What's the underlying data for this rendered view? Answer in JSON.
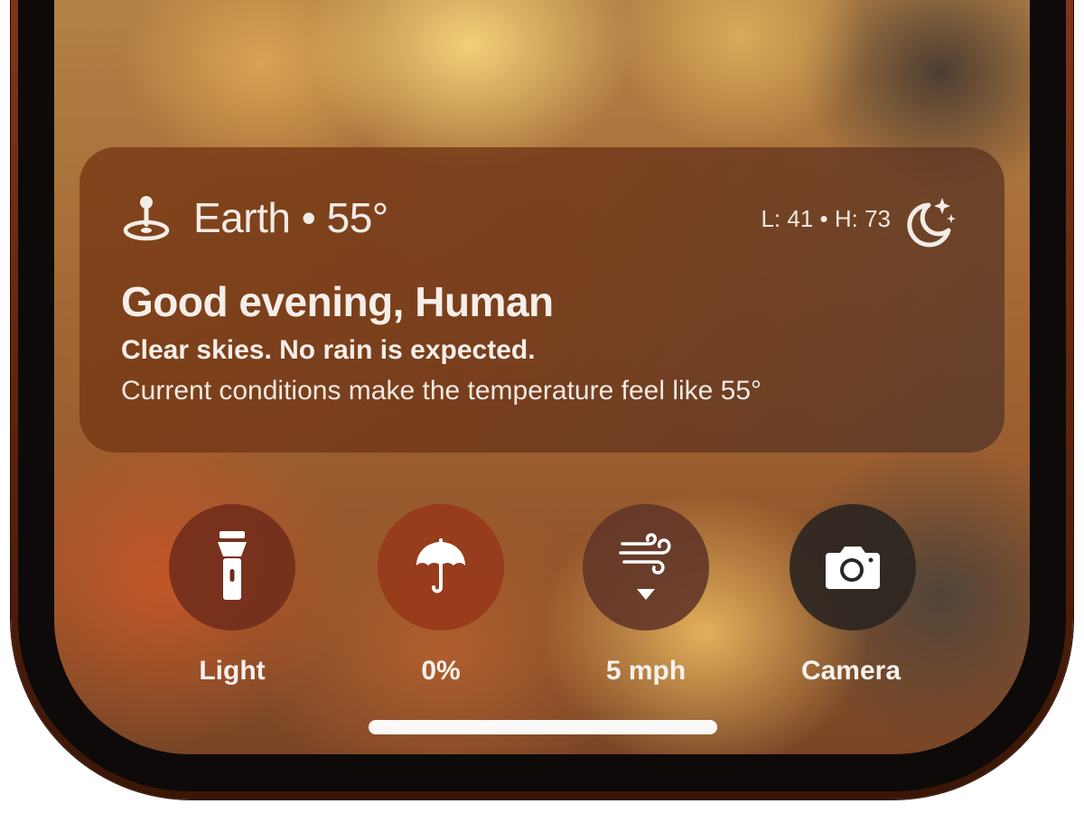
{
  "weather": {
    "location_icon": "location-pin-icon",
    "location": "Earth • 55°",
    "low_high": "L: 41 • H: 73",
    "condition_icon": "moon-stars-icon",
    "greeting": "Good evening, Human",
    "summary": "Clear skies. No rain is expected.",
    "detail": "Current conditions make the temperature feel like 55°"
  },
  "quick_actions": [
    {
      "icon": "flashlight-icon",
      "label": "Light"
    },
    {
      "icon": "umbrella-icon",
      "label": "0%"
    },
    {
      "icon": "wind-icon",
      "label": "5 mph"
    },
    {
      "icon": "camera-icon",
      "label": "Camera"
    }
  ],
  "colors": {
    "card_background": "#7a3a16",
    "text_primary": "#f4ece6",
    "light_button": "#702c1a",
    "rain_button": "#96381a",
    "wind_button": "#603428",
    "camera_button": "#2c2622",
    "home_indicator": "#fbf9f7"
  }
}
